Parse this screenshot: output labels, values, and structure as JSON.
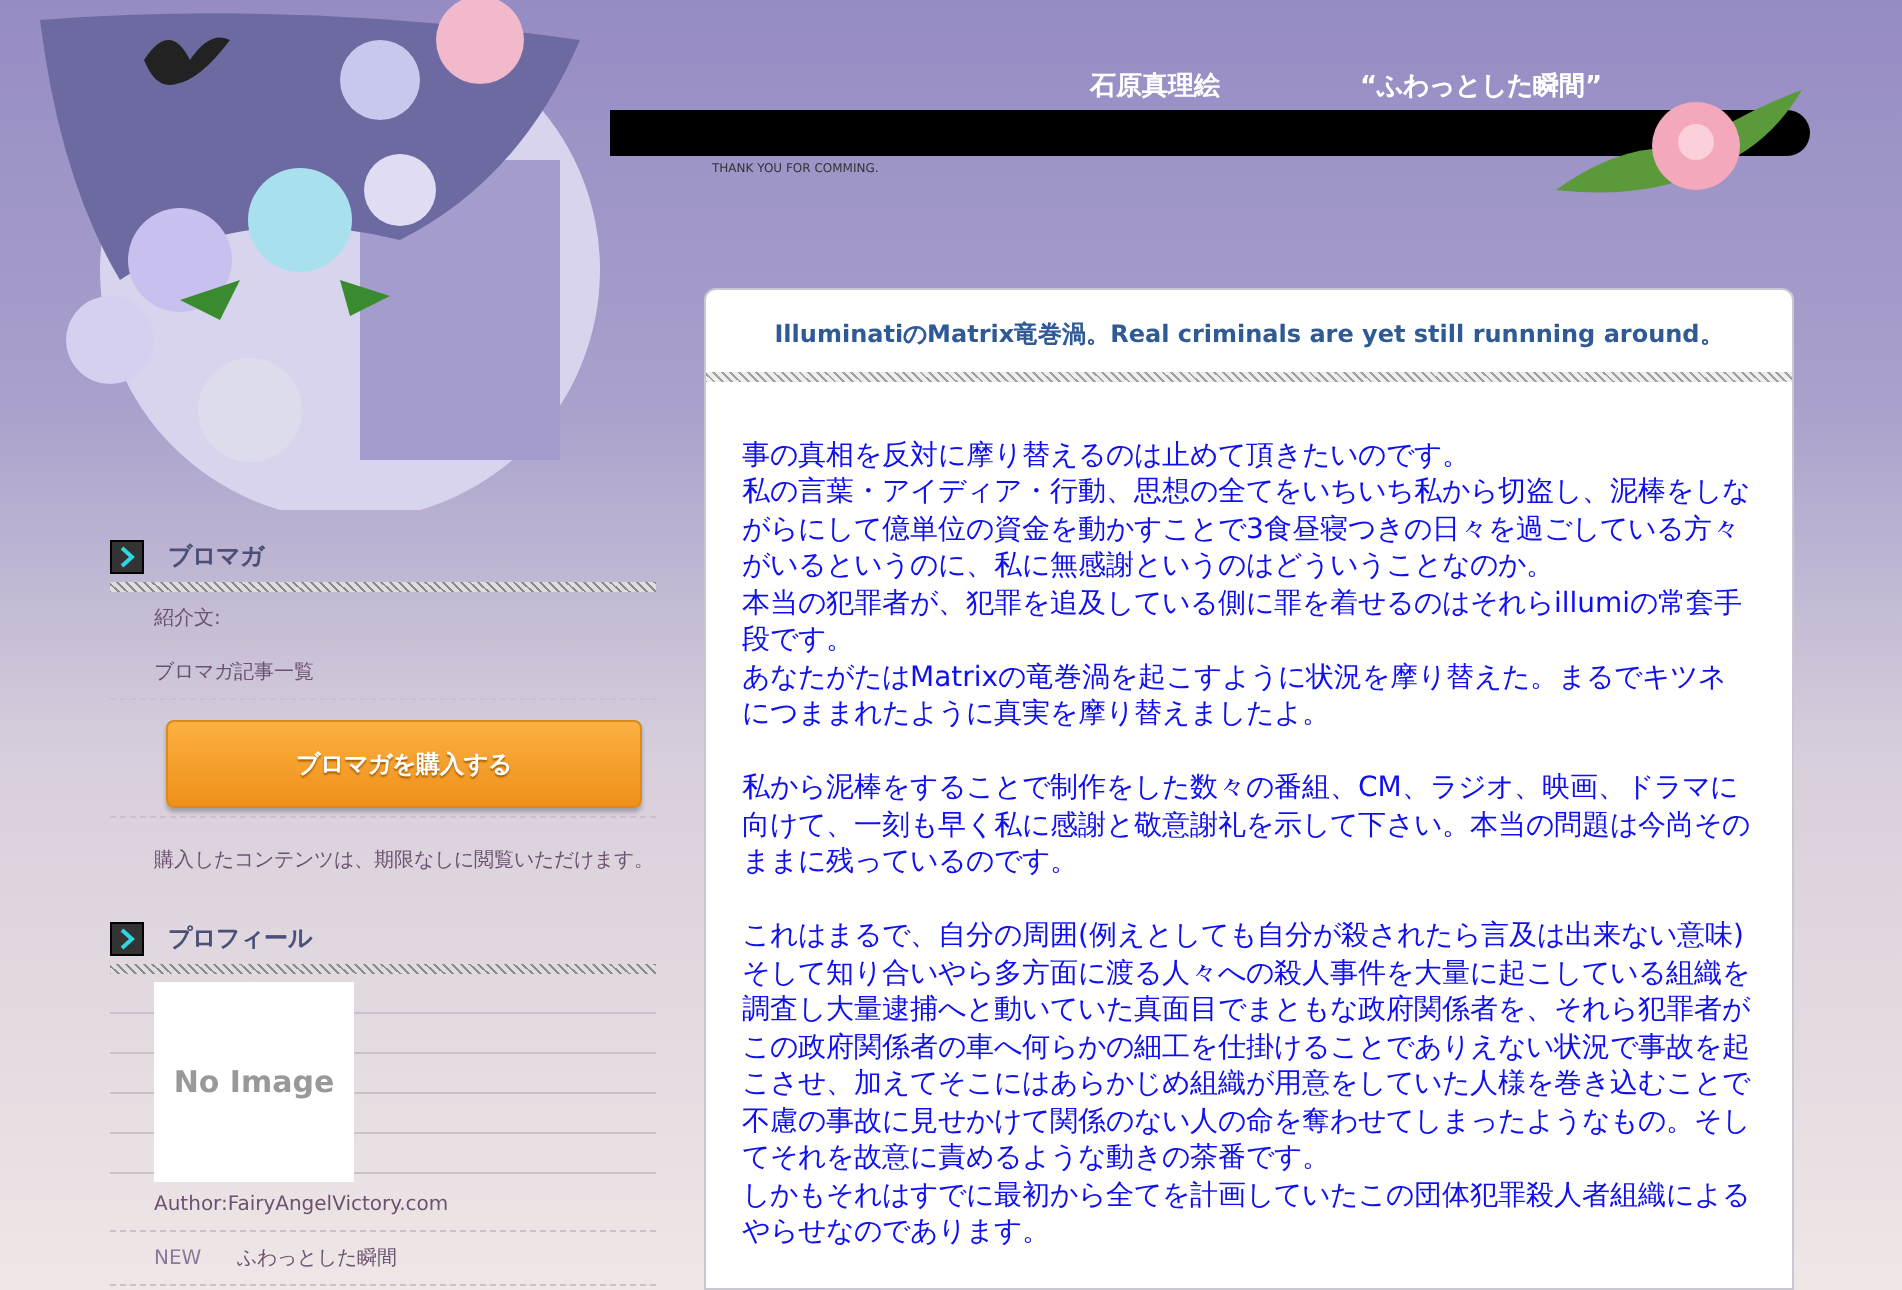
{
  "header": {
    "author": "石原真理絵",
    "blog_title": "“ふわっとした瞬間”",
    "tagline": "THANK YOU FOR COMMING."
  },
  "sidebar": [
    {
      "kind": "promaga",
      "heading": "ブロマガ",
      "links": [
        "紹介文:",
        "ブロマガ記事一覧"
      ],
      "button": "ブロマガを購入する",
      "note": "購入したコンテンツは、期限なしに閲覧いただけます。"
    },
    {
      "kind": "profile",
      "heading": "プロフィール",
      "image_text": "No Image",
      "lines": [
        "Author:FairyAngelVictory.com"
      ],
      "new_label": "NEW",
      "new_link": "ふわっとした瞬間"
    }
  ],
  "article": {
    "title": "IlluminatiのMatrix竜巻渦。Real criminals are yet still runnning around。",
    "paragraphs": [
      [
        "事の真相を反対に摩り替えるのは止めて頂きたいのです。",
        "私の言葉・アイディア・行動、思想の全てをいちいち私から切盗し、泥棒をしながらにして億単位の資金を動かすことで3食昼寝つきの日々を過ごしている方々がいるというのに、私に無感謝というのはどういうことなのか。",
        "本当の犯罪者が、犯罪を追及している側に罪を着せるのはそれらillumiの常套手段です。",
        "あなたがたはMatrixの竜巻渦を起こすように状況を摩り替えた。まるでキツネにつままれたように真実を摩り替えましたよ。"
      ],
      [
        "私から泥棒をすることで制作をした数々の番組、CM、ラジオ、映画、ドラマに向けて、一刻も早く私に感謝と敬意謝礼を示して下さい。本当の問題は今尚そのままに残っているのです。"
      ],
      [
        "これはまるで、自分の周囲(例えとしても自分が殺されたら言及は出来ない意味)そして知り合いやら多方面に渡る人々への殺人事件を大量に起こしている組織を調査し大量逮捕へと動いていた真面目でまともな政府関係者を、それら犯罪者がこの政府関係者の車へ何らかの細工を仕掛けることでありえない状況で事故を起こさせ、加えてそこにはあらかじめ組織が用意をしていた人様を巻き込むことで不慮の事故に見せかけて関係のない人の命を奪わせてしまったようなもの。そしてそれを故意に責めるような動きの茶番です。",
        "しかもそれはすでに最初から全てを計画していたこの団体犯罪殺人者組織によるやらせなのであります。"
      ]
    ]
  }
}
